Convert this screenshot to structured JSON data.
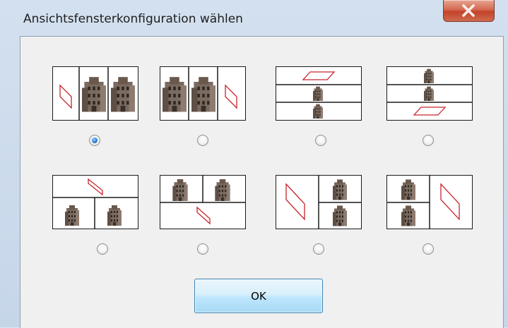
{
  "window": {
    "title": "Ansichtsfensterkonfiguration wählen",
    "close_icon": "close-icon"
  },
  "layouts": [
    {
      "id": "layout-1",
      "description": "three columns, 3D left",
      "selected": true
    },
    {
      "id": "layout-2",
      "description": "three columns, 3D right",
      "selected": false
    },
    {
      "id": "layout-3",
      "description": "three rows, 3D top",
      "selected": false
    },
    {
      "id": "layout-4",
      "description": "three rows, 3D bottom",
      "selected": false
    },
    {
      "id": "layout-5",
      "description": "3D top, two views bottom",
      "selected": false
    },
    {
      "id": "layout-6",
      "description": "two views top, 3D bottom",
      "selected": false
    },
    {
      "id": "layout-7",
      "description": "3D left, two views right",
      "selected": false
    },
    {
      "id": "layout-8",
      "description": "two views left, 3D right",
      "selected": false
    }
  ],
  "buttons": {
    "ok_label": "OK"
  },
  "colors": {
    "accent": "#3c7fb1",
    "shape_stroke": "#c8242c",
    "building": "#6e5a4e"
  }
}
